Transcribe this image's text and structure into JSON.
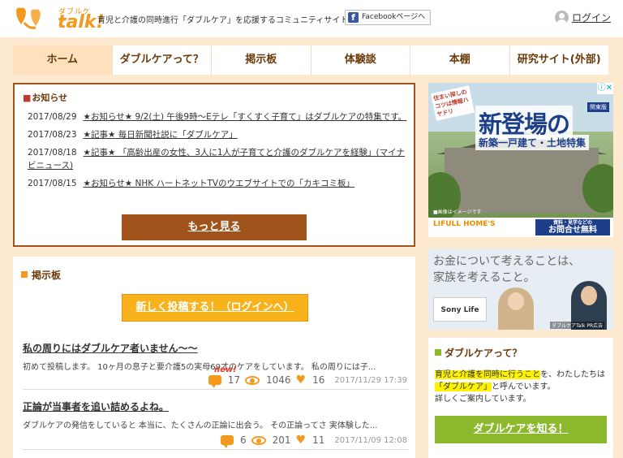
{
  "header": {
    "logo_sub": "ダブルケア",
    "logo_main": "talk!",
    "tagline": "育児と介護の同時進行「ダブルケア」を応援するコミュニティサイト",
    "facebook_label": "Facebookページへ",
    "login_label": "ログイン"
  },
  "nav": {
    "items": [
      {
        "label": "ホーム"
      },
      {
        "label": "ダブルケアって？"
      },
      {
        "label": "掲示板"
      },
      {
        "label": "体験談"
      },
      {
        "label": "本棚"
      },
      {
        "label": "研究サイト(外部)"
      }
    ]
  },
  "news": {
    "title": "お知らせ",
    "items": [
      {
        "date": "2017/08/29",
        "text": "★お知らせ★ 9/2(土) 午後9時〜Eテレ「すくすく子育て」はダブルケアの特集です。"
      },
      {
        "date": "2017/08/23",
        "text": "★記事★ 毎日新聞社説に「ダブルケア」"
      },
      {
        "date": "2017/08/18",
        "text": "★記事★ 「高齢出産の女性、3人に1人が子育てと介護のダブルケアを経験」(マイナビニュース)"
      },
      {
        "date": "2017/08/15",
        "text": "★お知らせ★ NHK ハートネットTVのウエブサイトでの「カキコミ板」"
      }
    ],
    "more_label": "もっと見る"
  },
  "bbs": {
    "title": "掲示板",
    "post_label": "新しく投稿する！（ログインへ）",
    "new_badge": "new!",
    "threads": [
      {
        "title": "私の周りにはダブルケア者いません〜〜",
        "excerpt": "初めて投稿します。 10ヶ月の息子と要介護5の実母69才のケアをしています。 私の周りには子...",
        "comments": "17",
        "views": "1046",
        "likes": "16",
        "date": "2017/11/29 17:39"
      },
      {
        "title": "正論が当事者を追い詰めるよね。",
        "excerpt": "ダブルケアの発信をしていると 本当に、たくさんの正論に出会う。 その正論ってさ 実体験した...",
        "comments": "6",
        "views": "201",
        "likes": "11",
        "date": "2017/11/09 12:08"
      }
    ]
  },
  "ad1": {
    "catch": "住まい探しのコツは情報ハヤドリ",
    "tag": "関東版",
    "headline": "新登場の",
    "sub": "新築一戸建て・土地特集",
    "note": "■画像はイメージです",
    "brand": "LIFULL HOME'S",
    "contact_small": "資料・見学などの",
    "contact": "お問合せ無料"
  },
  "ad2": {
    "copy_line1": "お金について考えることは、",
    "copy_line2": "家族を考えること。",
    "brand": "Sony Life",
    "pr": "ダブルケアTalk PR広告"
  },
  "about": {
    "title": "ダブルケアって？",
    "text_hl1": "育児と介護を同時に行うこと",
    "text_1": "を、わたしたちは",
    "text_hl2": "「ダブルケア」",
    "text_2": "と呼んでいます。",
    "text_3": "詳しくご案内しています。",
    "button_label": "ダブルケアを知る！"
  },
  "colors": {
    "accent": "#f39a1e",
    "brown": "#a0541b",
    "green": "#8cb82e",
    "background": "#fde9cf"
  }
}
